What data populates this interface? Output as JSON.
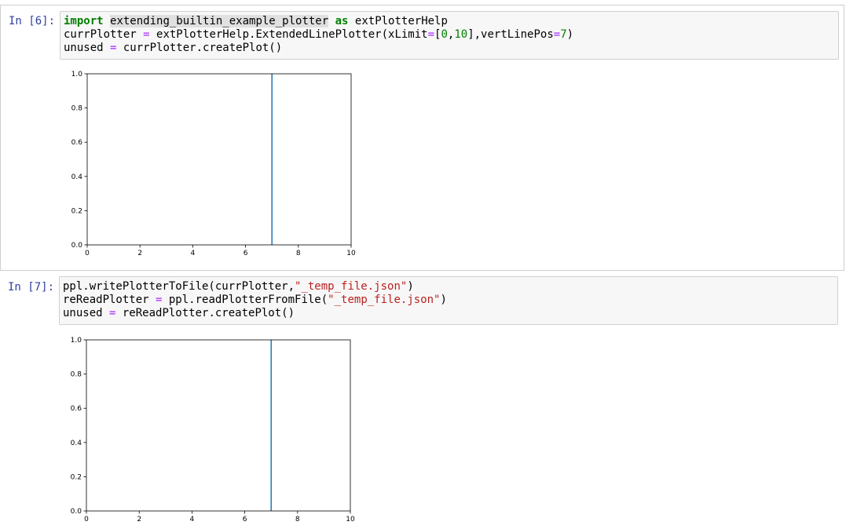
{
  "cells": [
    {
      "prompt": "In [6]:",
      "code": {
        "line1": {
          "kw_import": "import",
          "module": "extending_builtin_example_plotter",
          "kw_as": "as",
          "alias": "extPlotterHelp"
        },
        "line2": {
          "var": "currPlotter",
          "eq": " = ",
          "call": "extPlotterHelp.ExtendedLinePlotter(xLimit",
          "eq2": "=",
          "open": "[",
          "n0": "0",
          "comma": ",",
          "n10": "10",
          "close": "],vertLinePos",
          "eq3": "=",
          "n7": "7",
          "paren": ")"
        },
        "line3": {
          "var": "unused",
          "eq": " = ",
          "call": "currPlotter.createPlot()"
        }
      },
      "plot": {
        "y_ticks": [
          "0.0",
          "0.2",
          "0.4",
          "0.6",
          "0.8",
          "1.0"
        ],
        "x_ticks": [
          "0",
          "2",
          "4",
          "6",
          "8",
          "10"
        ]
      }
    },
    {
      "prompt": "In [7]:",
      "code": {
        "line1": {
          "call": "ppl.writePlotterToFile(currPlotter,",
          "str": "\"_temp_file.json\"",
          "paren": ")"
        },
        "line2": {
          "var": "reReadPlotter",
          "eq": " = ",
          "call": "ppl.readPlotterFromFile(",
          "str": "\"_temp_file.json\"",
          "paren": ")"
        },
        "line3": {
          "var": "unused",
          "eq": " = ",
          "call": "reReadPlotter.createPlot()"
        }
      },
      "plot": {
        "y_ticks": [
          "0.0",
          "0.2",
          "0.4",
          "0.6",
          "0.8",
          "1.0"
        ],
        "x_ticks": [
          "0",
          "2",
          "4",
          "6",
          "8",
          "10"
        ]
      }
    }
  ],
  "chart_data": [
    {
      "type": "line",
      "xlim": [
        0,
        10
      ],
      "ylim": [
        0,
        1
      ],
      "series": [
        {
          "x": [
            7,
            7
          ],
          "y": [
            0,
            1
          ],
          "color": "#1f77b4"
        }
      ],
      "grid": false
    },
    {
      "type": "line",
      "xlim": [
        0,
        10
      ],
      "ylim": [
        0,
        1
      ],
      "series": [
        {
          "x": [
            7,
            7
          ],
          "y": [
            0,
            1
          ],
          "color": "#1f77b4"
        }
      ],
      "grid": false
    }
  ]
}
